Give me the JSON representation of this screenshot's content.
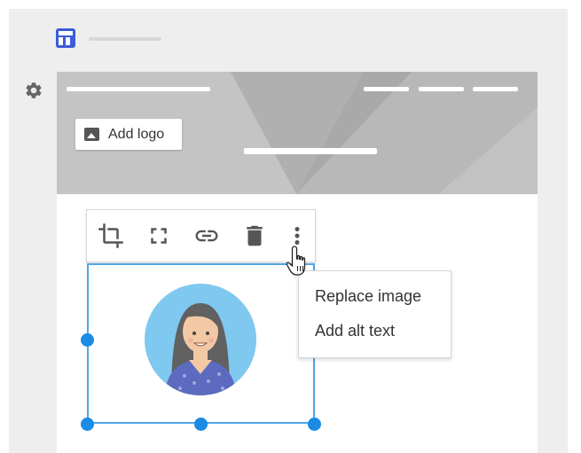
{
  "sidebar": {
    "site_icon": "site-layout-icon",
    "settings_icon": "gear-icon"
  },
  "header": {
    "add_logo_label": "Add logo",
    "add_logo_icon": "image-icon"
  },
  "image_toolbar": {
    "buttons": [
      {
        "name": "crop",
        "icon": "crop-icon"
      },
      {
        "name": "fullscreen",
        "icon": "fullscreen-icon"
      },
      {
        "name": "link",
        "icon": "link-icon"
      },
      {
        "name": "delete",
        "icon": "trash-icon"
      },
      {
        "name": "more",
        "icon": "more-vert-icon"
      }
    ]
  },
  "context_menu": {
    "items": [
      "Replace image",
      "Add alt text"
    ]
  },
  "colors": {
    "accent": "#1a8ce6",
    "site_icon": "#3b5bdb",
    "header_bg": "#bdbdbd",
    "avatar_bg": "#7fc8f0"
  }
}
